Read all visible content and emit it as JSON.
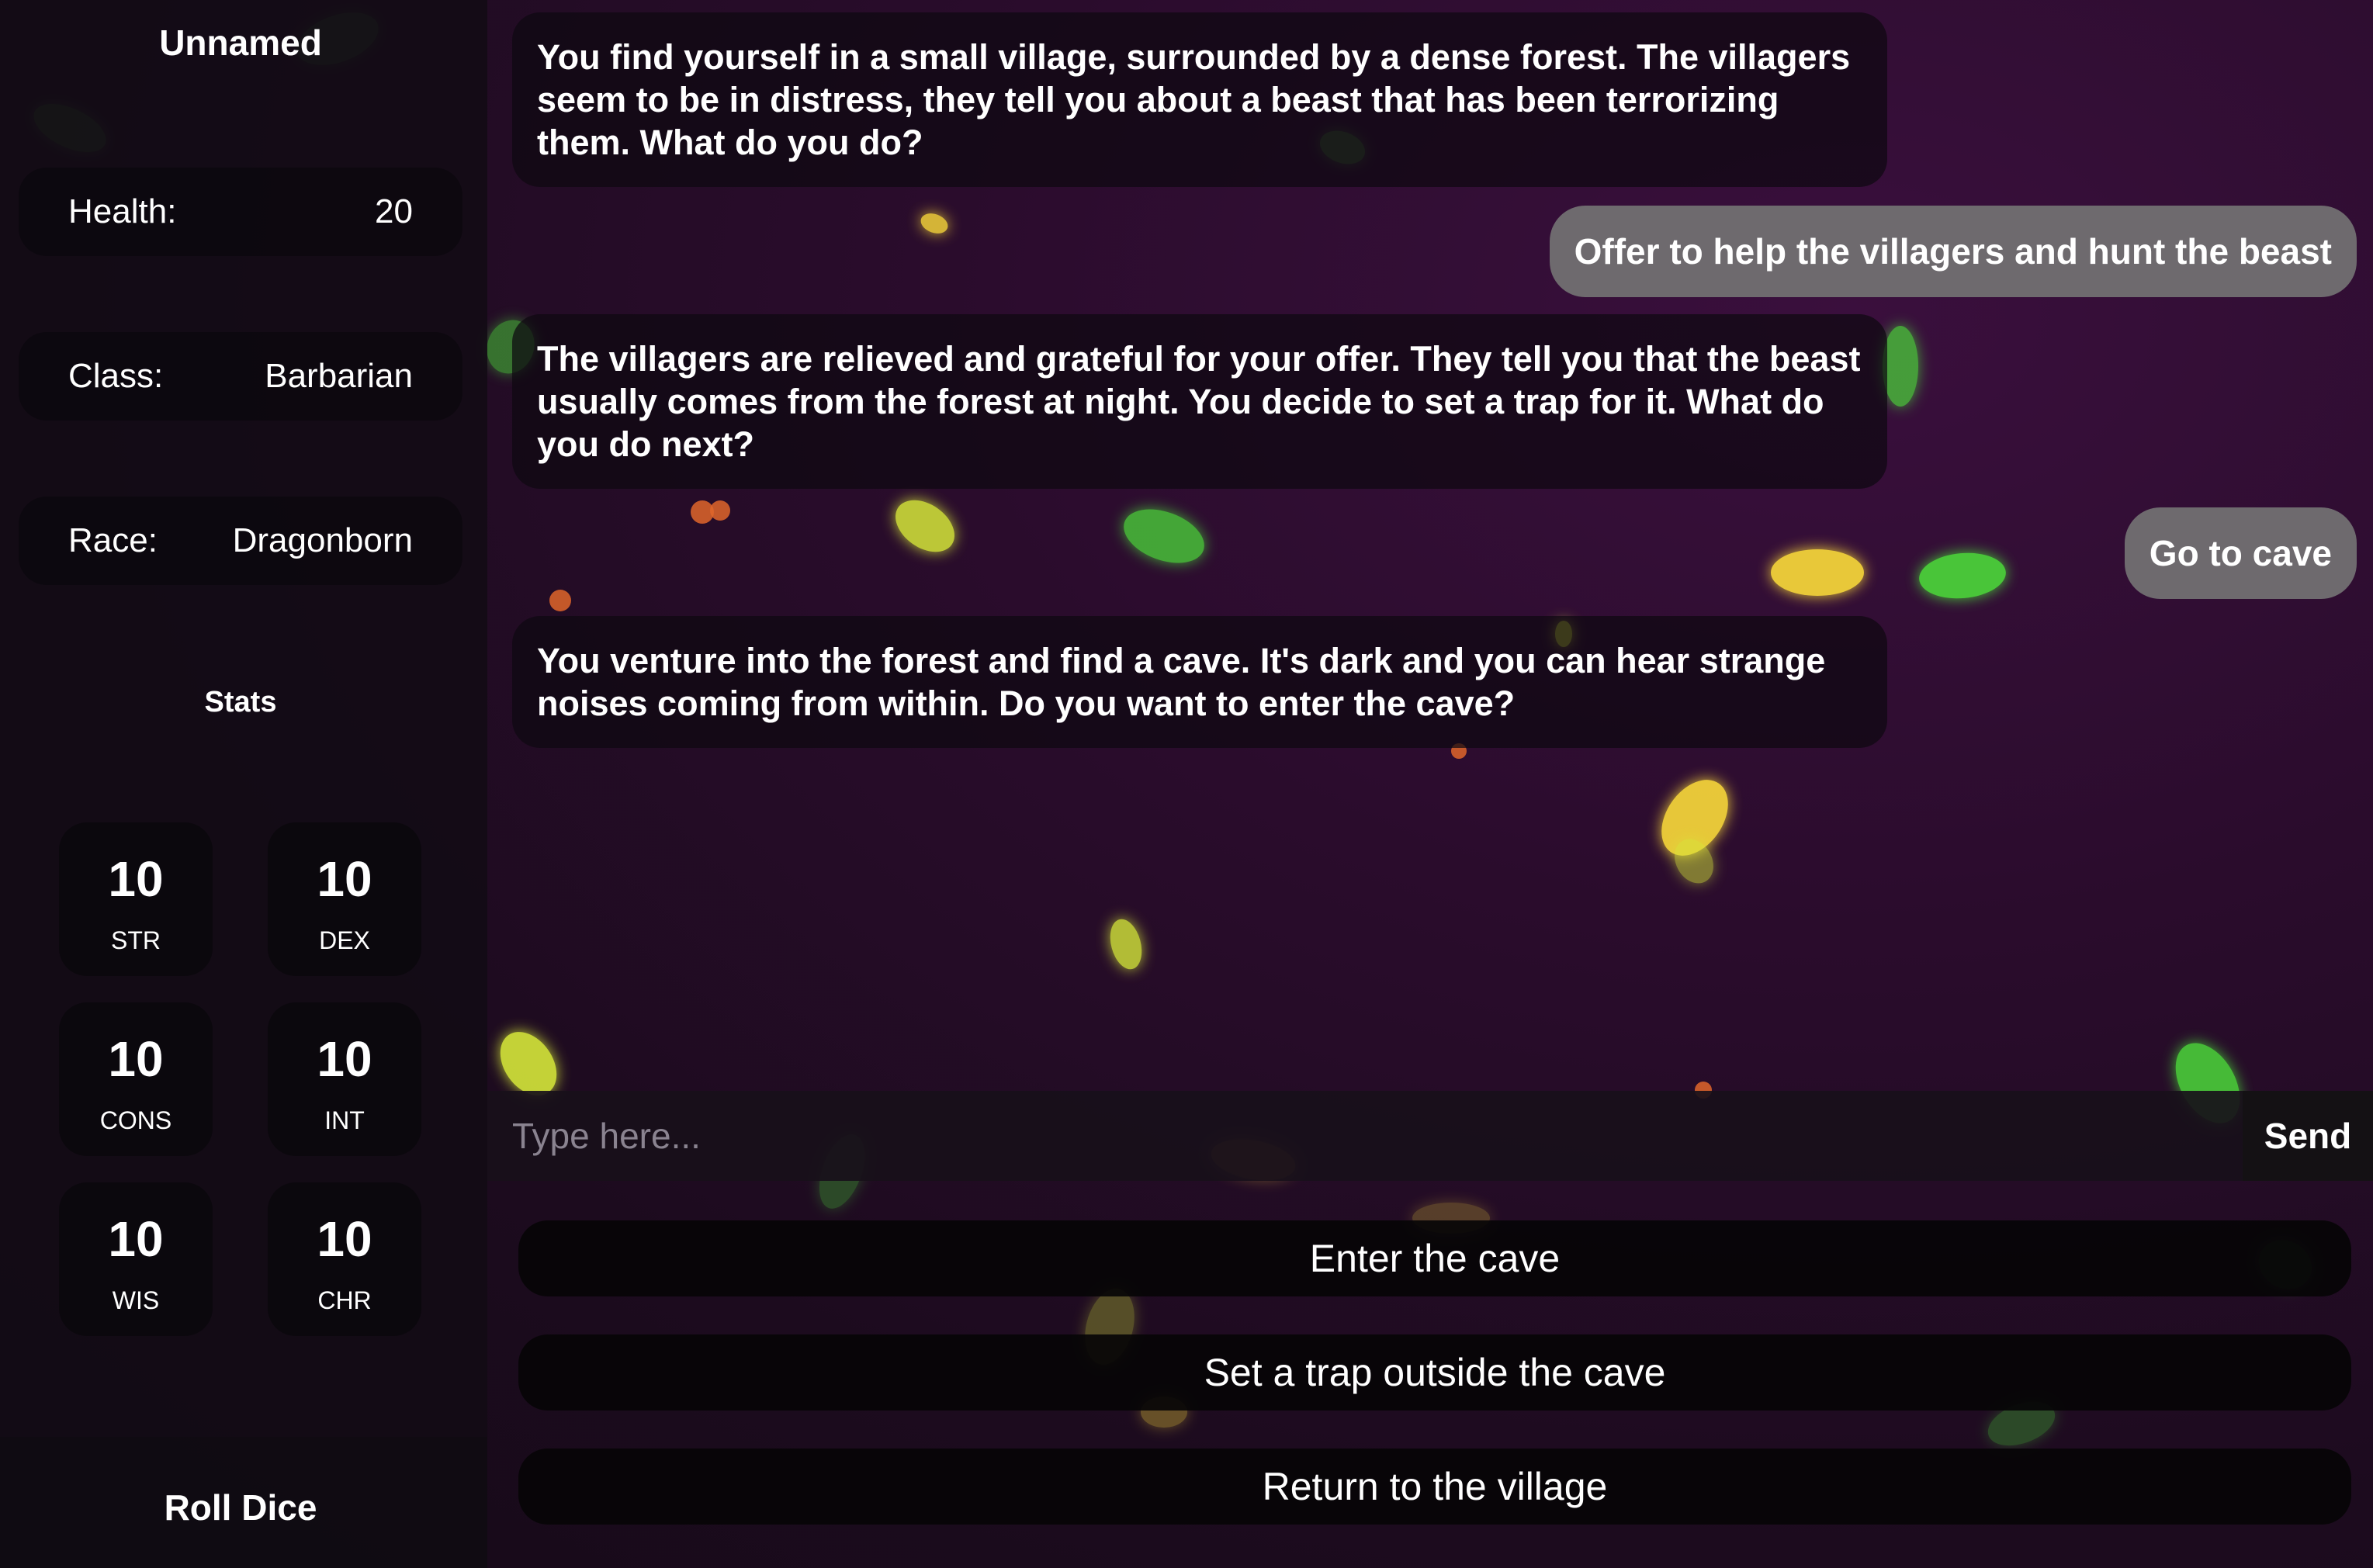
{
  "character": {
    "name": "Unnamed",
    "health_label": "Health:",
    "health_value": "20",
    "class_label": "Class:",
    "class_value": "Barbarian",
    "race_label": "Race:",
    "race_value": "Dragonborn"
  },
  "stats": {
    "title": "Stats",
    "items": [
      {
        "value": "10",
        "label": "STR"
      },
      {
        "value": "10",
        "label": "DEX"
      },
      {
        "value": "10",
        "label": "CONS"
      },
      {
        "value": "10",
        "label": "INT"
      },
      {
        "value": "10",
        "label": "WIS"
      },
      {
        "value": "10",
        "label": "CHR"
      }
    ]
  },
  "roll_dice_label": "Roll Dice",
  "messages": [
    {
      "role": "narrator",
      "text": "You find yourself in a small village, surrounded by a dense forest. The villagers seem to be in distress, they tell you about a beast that has been terrorizing them. What do you do?"
    },
    {
      "role": "player",
      "text": "Offer to help the villagers and hunt the beast"
    },
    {
      "role": "narrator",
      "text": "The villagers are relieved and grateful for your offer. They tell you that the beast usually comes from the forest at night. You decide to set a trap for it. What do you do next?"
    },
    {
      "role": "player",
      "text": "Go to cave"
    },
    {
      "role": "narrator",
      "text": "You venture into the forest and find a cave. It's dark and you can hear strange noises coming from within. Do you want to enter the cave?"
    }
  ],
  "input": {
    "placeholder": "Type here...",
    "value": "",
    "send_label": "Send"
  },
  "choices": [
    "Enter the cave",
    "Set a trap outside the cave",
    "Return to the village"
  ],
  "colors": {
    "background": "#1c0b1e",
    "leaf_green": "#4cd93a",
    "leaf_lime": "#d6e83a",
    "leaf_yellow": "#f2d23a",
    "leaf_orange": "#e0662a",
    "player_bubble": "#6e6a6e"
  }
}
